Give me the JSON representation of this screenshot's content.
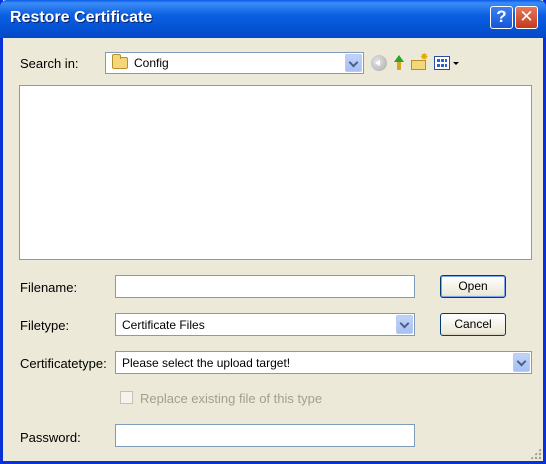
{
  "window": {
    "title": "Restore Certificate"
  },
  "titlebar": {
    "help_label": "?",
    "close_label": "✕"
  },
  "search": {
    "label": "Search in:",
    "location": "Config"
  },
  "toolbar": {
    "back_icon": "back-icon",
    "up_icon": "up-folder-icon",
    "new_folder_icon": "new-folder-icon",
    "views_icon": "views-icon"
  },
  "form": {
    "filename_label": "Filename:",
    "filename_value": "",
    "filetype_label": "Filetype:",
    "filetype_value": "Certificate Files",
    "certtype_label": "Certificatetype:",
    "certtype_value": "Please select the upload target!",
    "replace_label": "Replace existing file of this type",
    "replace_checked": false,
    "password_label": "Password:",
    "password_value": ""
  },
  "buttons": {
    "open_label": "Open",
    "cancel_label": "Cancel"
  },
  "colors": {
    "titlebar": "#0554d6",
    "window_bg": "#ece9d8",
    "disabled_text": "#a39f8e"
  }
}
